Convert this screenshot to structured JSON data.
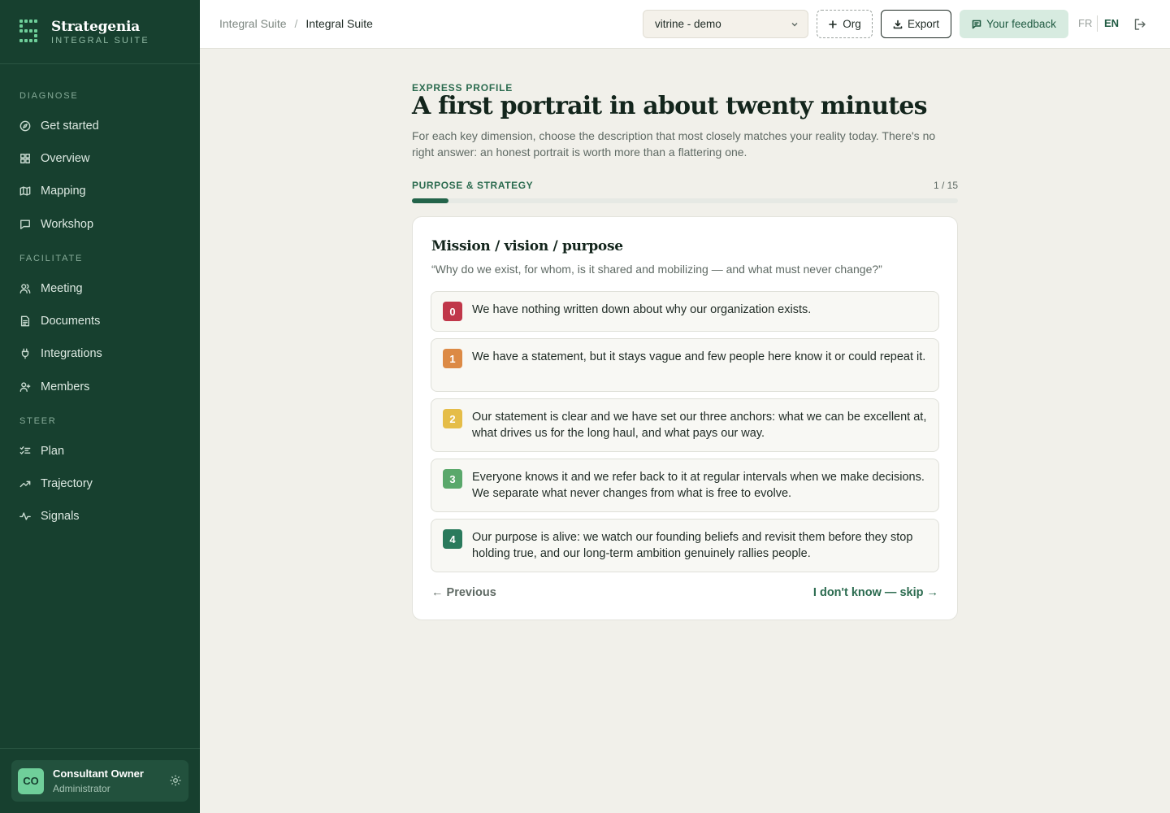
{
  "brand": {
    "name": "Strategenia",
    "subtitle": "INTEGRAL SUITE"
  },
  "sidebar": {
    "sections": [
      {
        "label": "DIAGNOSE",
        "items": [
          {
            "label": "Get started",
            "icon": "compass-icon"
          },
          {
            "label": "Overview",
            "icon": "grid-icon"
          },
          {
            "label": "Mapping",
            "icon": "map-icon"
          },
          {
            "label": "Workshop",
            "icon": "chat-icon"
          }
        ]
      },
      {
        "label": "FACILITATE",
        "items": [
          {
            "label": "Meeting",
            "icon": "users-icon"
          },
          {
            "label": "Documents",
            "icon": "document-icon"
          },
          {
            "label": "Integrations",
            "icon": "plug-icon"
          },
          {
            "label": "Members",
            "icon": "user-plus-icon"
          }
        ]
      },
      {
        "label": "STEER",
        "items": [
          {
            "label": "Plan",
            "icon": "checklist-icon"
          },
          {
            "label": "Trajectory",
            "icon": "trend-icon"
          },
          {
            "label": "Signals",
            "icon": "pulse-icon"
          }
        ]
      }
    ]
  },
  "user": {
    "initials": "CO",
    "name": "Consultant Owner",
    "role": "Administrator"
  },
  "topbar": {
    "breadcrumb": [
      "Integral Suite",
      "Integral Suite"
    ],
    "breadcrumb_sep": "/",
    "org_select": "vitrine - demo",
    "org_button": "Org",
    "export_button": "Export",
    "feedback_button": "Your feedback",
    "lang_fr": "FR",
    "lang_en": "EN"
  },
  "main": {
    "eyebrow": "EXPRESS PROFILE",
    "title": "A first portrait in about twenty minutes",
    "intro": "For each key dimension, choose the description that most closely matches your reality today. There's no right answer: an honest portrait is worth more than a flattering one.",
    "dimension": "PURPOSE & STRATEGY",
    "progress_text": "1 / 15",
    "progress_fraction": 0.0667
  },
  "question": {
    "title": "Mission / vision / purpose",
    "subtitle": "“Why do we exist, for whom, is it shared and mobilizing — and what must never change?”",
    "options": [
      {
        "level": "0",
        "color": "#c0374a",
        "text": "We have nothing written down about why our organization exists."
      },
      {
        "level": "1",
        "color": "#dc8a45",
        "text": "We have a statement, but it stays vague and few people here know it or could repeat it."
      },
      {
        "level": "2",
        "color": "#e5bd48",
        "text": "Our statement is clear and we have set our three anchors: what we can be excellent at, what drives us for the long haul, and what pays our way."
      },
      {
        "level": "3",
        "color": "#5aa86b",
        "text": "Everyone knows it and we refer back to it at regular intervals when we make decisions. We separate what never changes from what is free to evolve."
      },
      {
        "level": "4",
        "color": "#2a7a5c",
        "text": "Our purpose is alive: we watch our founding beliefs and revisit them before they stop holding true, and our long-term ambition genuinely rallies people."
      }
    ],
    "previous": "← Previous",
    "skip": "I don't know — skip →"
  }
}
